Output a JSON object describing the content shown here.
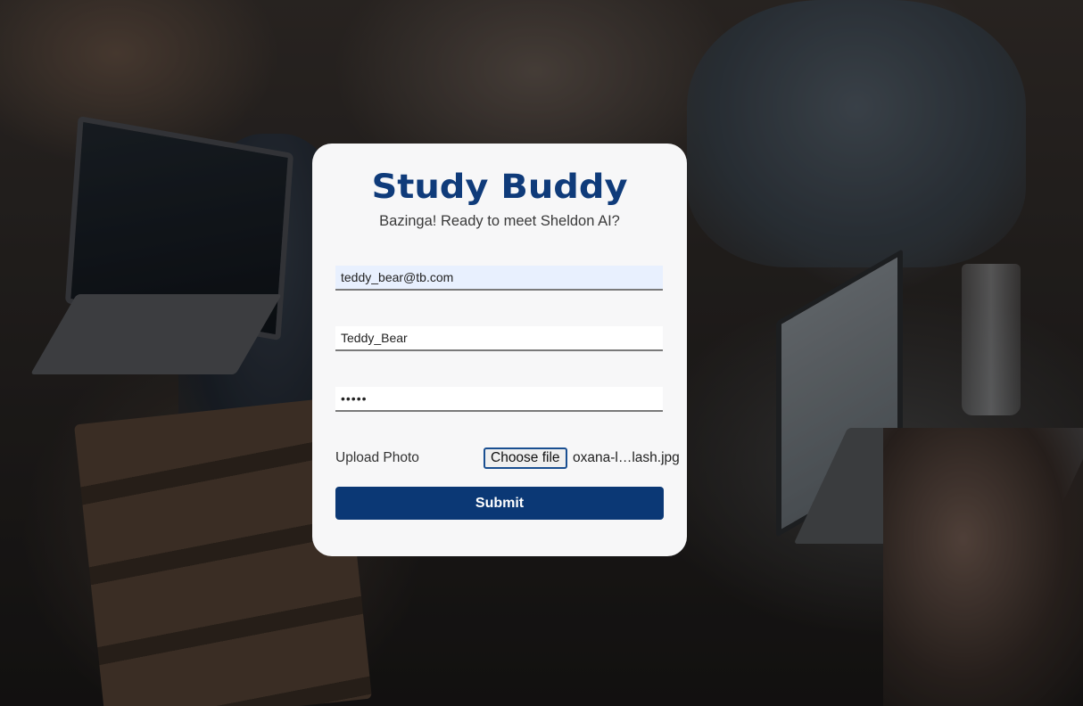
{
  "app": {
    "title": "Study Buddy",
    "subtitle": "Bazinga! Ready to meet Sheldon AI?"
  },
  "form": {
    "email_value": "teddy_bear@tb.com",
    "username_value": "Teddy_Bear",
    "password_value": "•••••",
    "upload_label": "Upload Photo",
    "file_button_label": "Choose file",
    "file_name": "oxana-l…lash.jpg",
    "submit_label": "Submit"
  },
  "colors": {
    "brand": "#0f3b7a",
    "submit_bg": "#0b3875",
    "card_bg": "#f7f7f8",
    "autofill_bg": "#e8f0fe"
  }
}
